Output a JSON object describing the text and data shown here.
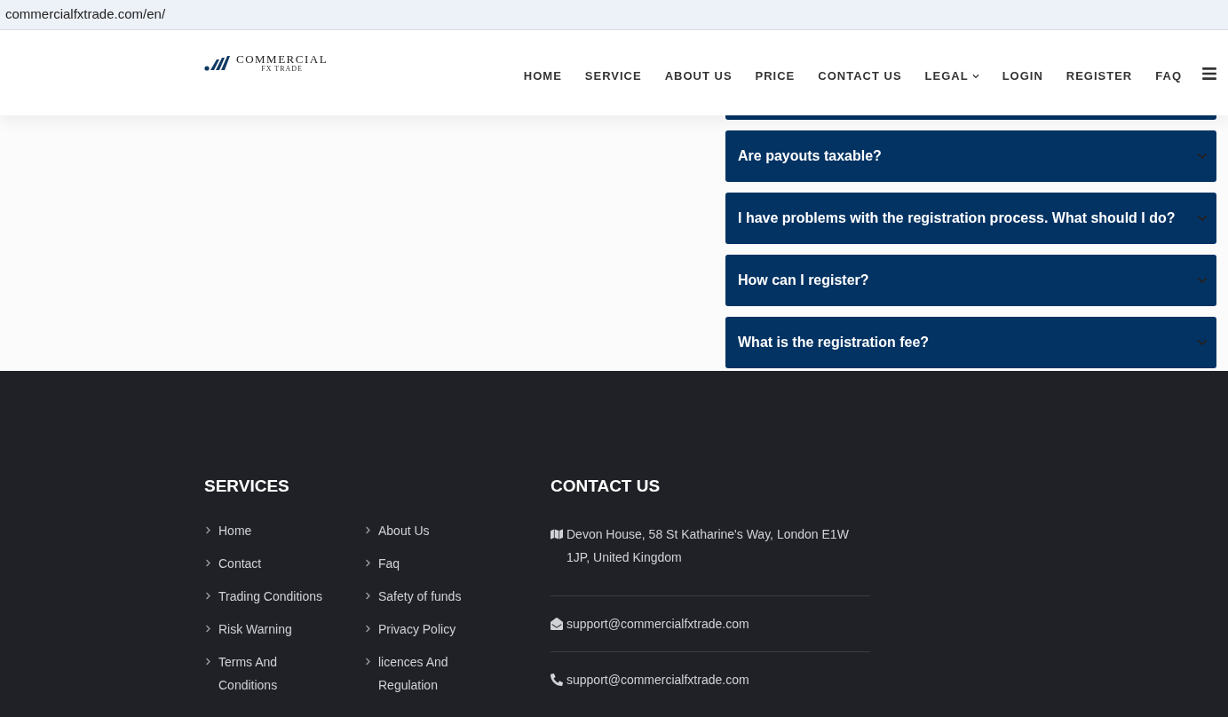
{
  "address_bar": {
    "url": "commercialfxtrade.com/en/"
  },
  "header": {
    "logo": {
      "name": "COMMERCIAL",
      "tagline": "FX TRADE"
    },
    "nav": [
      {
        "label": "HOME",
        "has_dropdown": false
      },
      {
        "label": "SERVICE",
        "has_dropdown": false
      },
      {
        "label": "ABOUT US",
        "has_dropdown": false
      },
      {
        "label": "PRICE",
        "has_dropdown": false
      },
      {
        "label": "CONTACT US",
        "has_dropdown": false
      },
      {
        "label": "LEGAL",
        "has_dropdown": true
      },
      {
        "label": "LOGIN",
        "has_dropdown": false
      },
      {
        "label": "REGISTER",
        "has_dropdown": false
      },
      {
        "label": "FAQ",
        "has_dropdown": false
      }
    ]
  },
  "faq": [
    {
      "question": "Are payouts taxable?",
      "expanded": false
    },
    {
      "question": "I have problems with the registration process. What should I do?",
      "expanded": false
    },
    {
      "question": "How can I register?",
      "expanded": false
    },
    {
      "question": "What is the registration fee?",
      "expanded": false
    }
  ],
  "footer": {
    "services": {
      "title": "SERVICES",
      "columns": [
        [
          "Home",
          "Contact",
          "Trading Conditions",
          "Risk Warning",
          "Terms And Conditions"
        ],
        [
          "About Us",
          "Faq",
          "Safety of funds",
          "Privacy Policy",
          "licences And Regulation"
        ]
      ]
    },
    "contact": {
      "title": "CONTACT US",
      "items": [
        {
          "kind": "address",
          "text": "Devon House, 58 St Katharine's Way, London E1W 1JP, United Kingdom"
        },
        {
          "kind": "email",
          "text": "support@commercialfxtrade.com"
        },
        {
          "kind": "phone",
          "text": "support@commercialfxtrade.com"
        }
      ]
    }
  }
}
